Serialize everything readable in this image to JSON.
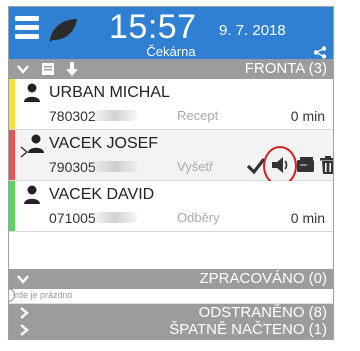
{
  "header": {
    "time": "15:57",
    "date": "9. 7. 2018",
    "subtitle": "Čekárna"
  },
  "sections": {
    "queue": {
      "label": "FRONTA",
      "count": "(3)",
      "text": "FRONTA  (3)"
    },
    "processed": {
      "text": "ZPRACOVÁNO  (0)",
      "empty_text": "rde je prázdno"
    },
    "removed": {
      "text": "ODSTRANĚNO  (8)"
    },
    "misread": {
      "text": "ŠPATNĚ NAČTENO  (1)"
    }
  },
  "queue_rows": [
    {
      "name": "URBAN MICHAL",
      "code": "780302",
      "kind": "Recept",
      "duration": "0 min",
      "status_color": "#f2e23a"
    },
    {
      "name": "VACEK JOSEF",
      "code": "790305",
      "kind": "Vyšetř",
      "duration": "",
      "status_color": "#e05555"
    },
    {
      "name": "VACEK DAVID",
      "code": "071005",
      "kind": "Odběry",
      "duration": "0 min",
      "status_color": "#5fd35f"
    }
  ],
  "colors": {
    "header_blue": "#2f7fd3",
    "section_gray": "#9c9c9c",
    "highlight_red": "#d22020"
  },
  "icons": {
    "menu": "hamburger-icon",
    "leaf": "leaf-icon",
    "share": "share-icon",
    "person": "person-icon",
    "check": "check-icon",
    "speaker": "speaker-icon",
    "card": "card-icon",
    "trash": "trash-icon"
  }
}
